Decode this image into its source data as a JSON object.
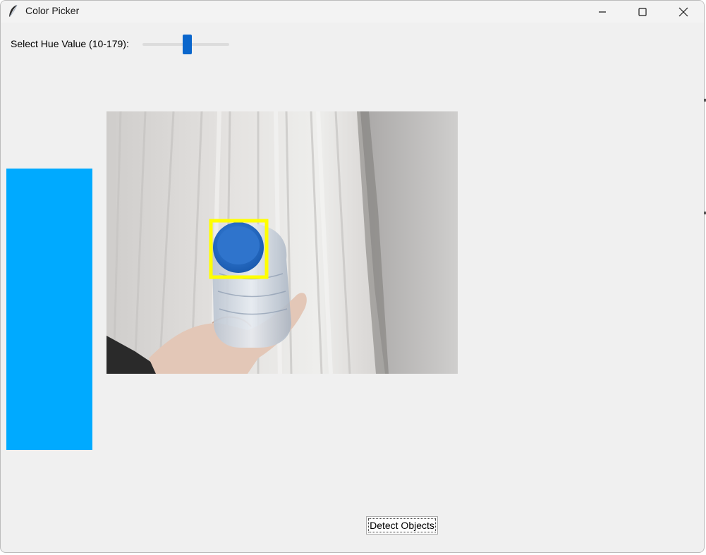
{
  "window": {
    "title": "Color Picker"
  },
  "controls": {
    "hue_label": "Select Hue Value (10-179):",
    "hue_min": 10,
    "hue_max": 179,
    "hue_value": 90,
    "detect_button_label": "Detect Objects"
  },
  "icons": {
    "app": "feather-icon",
    "minimize": "minimize-icon",
    "maximize": "maximize-icon",
    "close": "close-icon"
  },
  "colors": {
    "selected_hue_swatch": "#00aaff",
    "slider_thumb": "#0a66cc",
    "detection_box": "#ffff00",
    "bottle_cap": "#1f6fd0"
  }
}
